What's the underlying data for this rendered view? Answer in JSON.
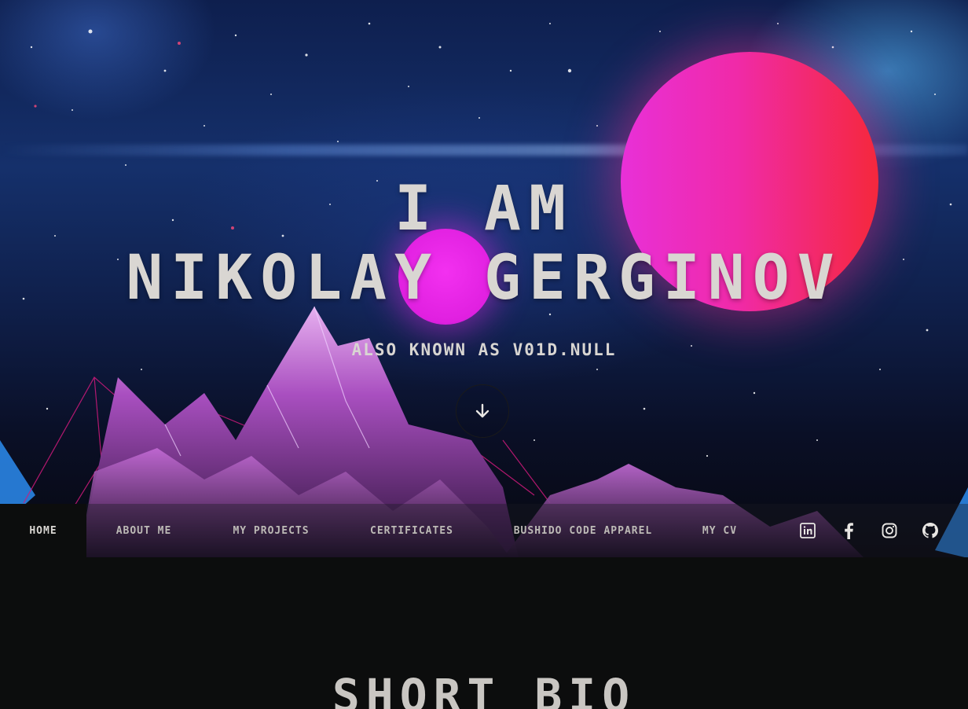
{
  "hero": {
    "title_line1": "I AM",
    "title_line2": "NIKOLAY GERGINOV",
    "subtitle": "ALSO KNOWN AS V01D.NULL",
    "scroll_icon": "arrow-down-icon"
  },
  "nav": {
    "items": [
      {
        "label": "HOME",
        "active": true
      },
      {
        "label": "ABOUT ME",
        "active": false
      },
      {
        "label": "MY PROJECTS",
        "active": false
      },
      {
        "label": "CERTIFICATES",
        "active": false
      },
      {
        "label": "BUSHIDO CODE APPAREL",
        "active": false
      },
      {
        "label": "MY CV",
        "active": false
      }
    ],
    "social": [
      "linkedin-icon",
      "facebook-icon",
      "instagram-icon",
      "github-icon"
    ]
  },
  "bio": {
    "title": "SHORT BIO"
  },
  "colors": {
    "text": "#d9d6d2",
    "planet_pink": "#e830d8",
    "planet_red": "#f5283c",
    "dark_bg": "#0c0d0d"
  }
}
